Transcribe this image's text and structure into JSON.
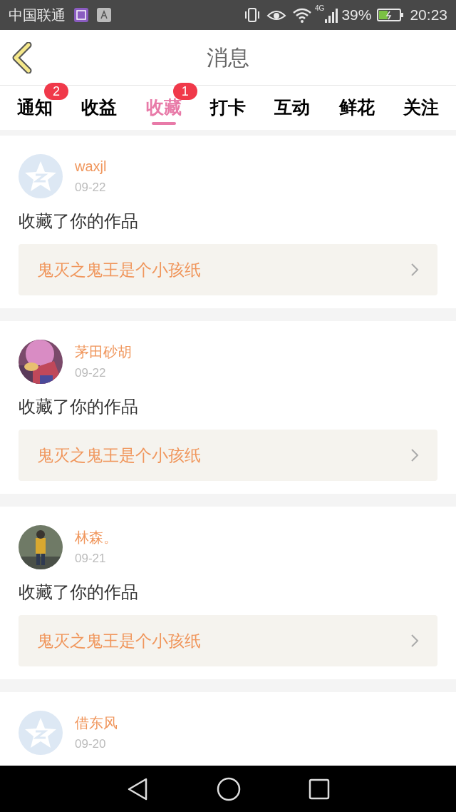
{
  "status_bar": {
    "carrier": "中国联通",
    "network": "4G",
    "battery": "39%",
    "time": "20:23"
  },
  "header": {
    "title": "消息"
  },
  "tabs": [
    {
      "label": "通知",
      "selected": false,
      "badge": "2"
    },
    {
      "label": "收益",
      "selected": false
    },
    {
      "label": "收藏",
      "selected": true,
      "badge": "1"
    },
    {
      "label": "打卡",
      "selected": false
    },
    {
      "label": "互动",
      "selected": false
    },
    {
      "label": "鲜花",
      "selected": false
    },
    {
      "label": "关注",
      "selected": false
    }
  ],
  "messages": [
    {
      "avatar": {
        "kind": "default"
      },
      "name": "waxjl",
      "date": "09-22",
      "action": "收藏了你的作品",
      "work": "鬼灭之鬼王是个小孩纸"
    },
    {
      "name": "茅田砂胡",
      "date": "09-22",
      "action": "收藏了你的作品",
      "work": "鬼灭之鬼王是个小孩纸"
    },
    {
      "name": "林森。",
      "date": "09-21",
      "action": "收藏了你的作品",
      "work": "鬼灭之鬼王是个小孩纸"
    },
    {
      "avatar": {
        "kind": "default"
      },
      "name": "借东风",
      "date": "09-20"
    }
  ]
}
